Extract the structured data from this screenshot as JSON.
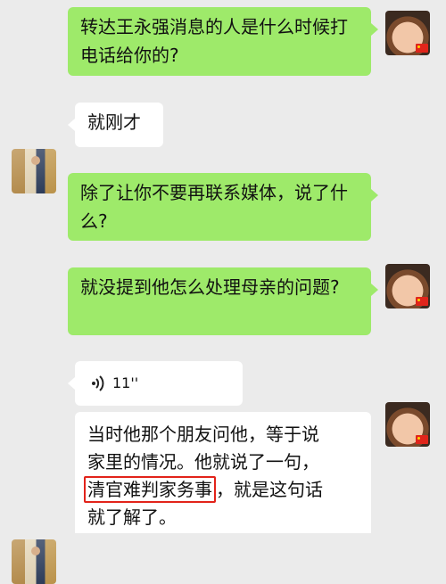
{
  "messages": [
    {
      "side": "right",
      "type": "text",
      "text": "转达王永强消息的人是什么时候打电话给你的?"
    },
    {
      "side": "left",
      "type": "text",
      "text": "就刚才"
    },
    {
      "side": "right",
      "type": "text",
      "text": "除了让你不要再联系媒体，说了什么?"
    },
    {
      "side": "right",
      "type": "text",
      "text": "就没提到他怎么处理母亲的问题?"
    },
    {
      "side": "left",
      "type": "voice",
      "duration": "11''"
    },
    {
      "side": "left",
      "type": "text",
      "lines": [
        "当时他那个朋友问他，等于说",
        "家里的情况。他就说了一句，",
        "清官难判家务事",
        "，就是这句话",
        "就了解了。"
      ]
    }
  ],
  "colors": {
    "background": "#ebebeb",
    "sent_bubble": "#9eea6a",
    "received_bubble": "#ffffff",
    "highlight_box": "#e2231a"
  }
}
